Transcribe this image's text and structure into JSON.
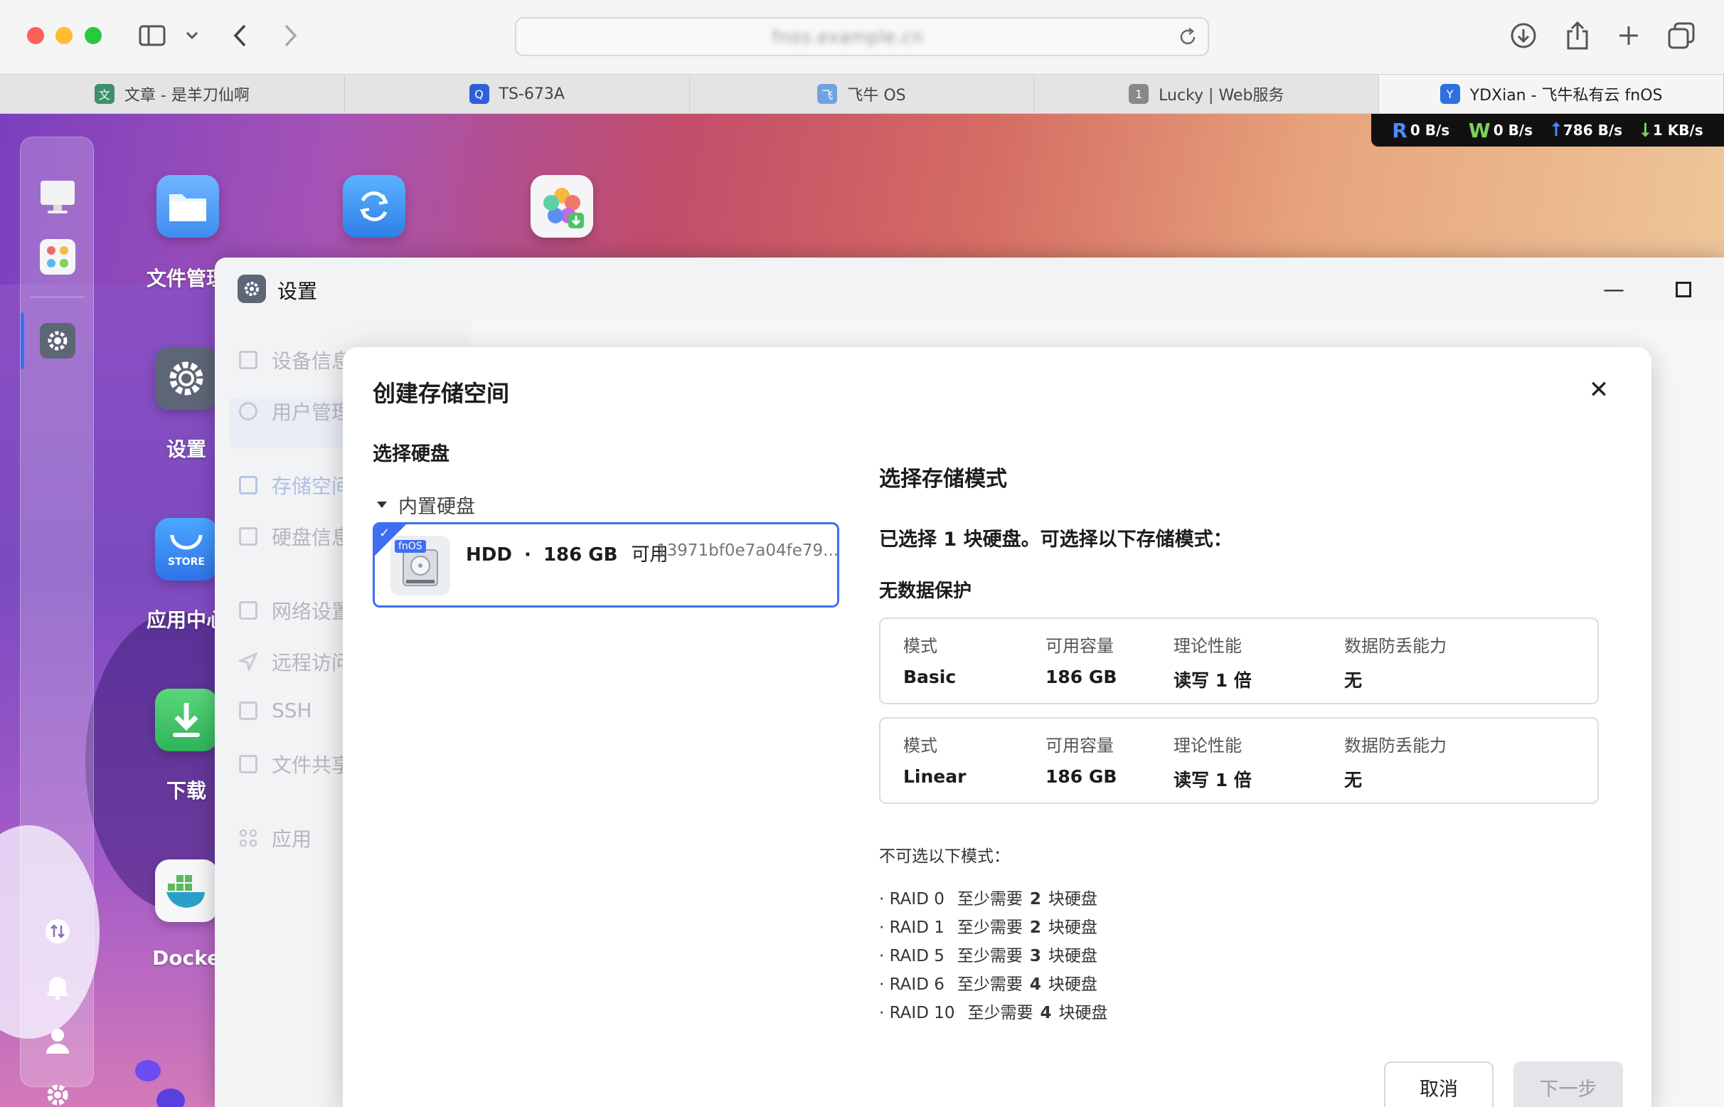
{
  "browser": {
    "url": "fnos.example.cn",
    "tabs": [
      {
        "label": "文章 - 是羊刀仙啊",
        "icon_color": "#3f8f6a",
        "icon_char": "文"
      },
      {
        "label": "TS-673A",
        "icon_color": "#2f5fd8",
        "icon_char": "Q"
      },
      {
        "label": "飞牛 OS",
        "icon_color": "#6fa3e0",
        "icon_char": "飞"
      },
      {
        "label": "Lucky | Web服务",
        "icon_color": "#888888",
        "icon_char": "1"
      },
      {
        "label": "YDXian - 飞牛私有云 fnOS",
        "icon_color": "#2f6fe0",
        "icon_char": "Y",
        "active": true
      }
    ]
  },
  "speed": {
    "read_label": "R",
    "read": "0 B/s",
    "write_label": "W",
    "write": "0 B/s",
    "upload": "786 B/s",
    "download": "1 KB/s"
  },
  "desktop": {
    "icons": [
      {
        "label": "文件管理",
        "icon": "folder-icon"
      },
      {
        "label": "设置",
        "icon": "gear-icon"
      },
      {
        "label": "应用中心",
        "icon": "store-icon"
      },
      {
        "label": "下载",
        "icon": "download-icon"
      },
      {
        "label": "Docker",
        "icon": "docker-icon"
      }
    ],
    "store_text": "STORE"
  },
  "settings": {
    "title": "设置",
    "nav": [
      {
        "label": "设备信息"
      },
      {
        "label": "用户管理"
      },
      {
        "label": "存储空间",
        "active": true
      },
      {
        "label": "硬盘信息"
      },
      {
        "label": "网络设置"
      },
      {
        "label": "远程访问"
      },
      {
        "label": "SSH"
      },
      {
        "label": "文件共享"
      },
      {
        "label": "应用"
      }
    ]
  },
  "modal": {
    "title": "创建存储空间",
    "select_disk_title": "选择硬盘",
    "disk_group": "内置硬盘",
    "disk": {
      "type": "HDD",
      "separator": "·",
      "size": "186 GB",
      "avail": "可用",
      "id": "13971bf0e7a04fe79...",
      "badge": "fnOS"
    },
    "mode_title": "选择存储模式",
    "summary": "已选择 1 块硬盘。可选择以下存储模式：",
    "no_protect_title": "无数据保护",
    "columns": [
      "模式",
      "可用容量",
      "理论性能",
      "数据防丢能力"
    ],
    "modes": [
      {
        "mode": "Basic",
        "capacity": "186 GB",
        "perf": "读写 1 倍",
        "protect": "无"
      },
      {
        "mode": "Linear",
        "capacity": "186 GB",
        "perf": "读写 1 倍",
        "protect": "无"
      }
    ],
    "unavailable_title": "不可选以下模式：",
    "raid": [
      {
        "name": "RAID 0",
        "pre": "至少需要",
        "count": "2",
        "post": "块硬盘"
      },
      {
        "name": "RAID 1",
        "pre": "至少需要",
        "count": "2",
        "post": "块硬盘"
      },
      {
        "name": "RAID 5",
        "pre": "至少需要",
        "count": "3",
        "post": "块硬盘"
      },
      {
        "name": "RAID 6",
        "pre": "至少需要",
        "count": "4",
        "post": "块硬盘"
      },
      {
        "name": "RAID 10",
        "pre": "至少需要",
        "count": "4",
        "post": "块硬盘"
      }
    ],
    "cancel": "取消",
    "next": "下一步"
  }
}
